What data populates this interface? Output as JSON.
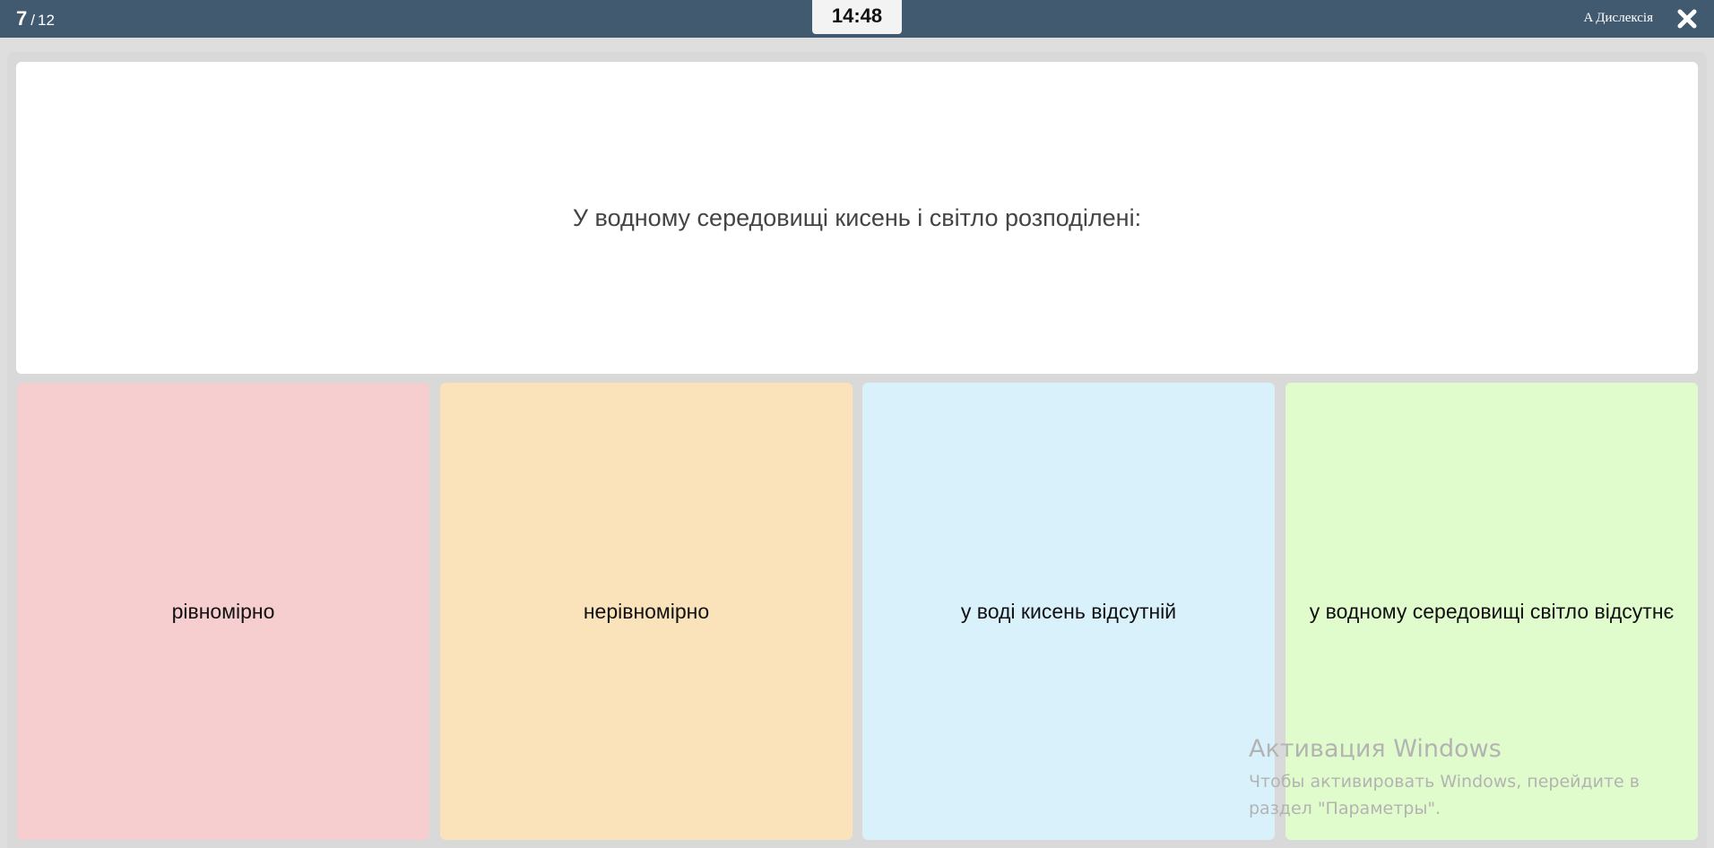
{
  "header": {
    "progress_current": "7",
    "progress_separator": "/",
    "progress_total": "12",
    "timer": "14:48",
    "dyslexia_label": "A Дислексія",
    "close_icon": "close-icon"
  },
  "question": {
    "text": "У водному середовищі кисень і світло розподілені:"
  },
  "answers": [
    {
      "label": "рівномірно",
      "color": "#f6cecf"
    },
    {
      "label": "нерівномірно",
      "color": "#fae2bb"
    },
    {
      "label": "у воді кисень відсутній",
      "color": "#d8f1fb"
    },
    {
      "label": "у водному середовищі світло відсутнє",
      "color": "#e0fccc"
    }
  ],
  "watermark": {
    "title": "Активация Windows",
    "line1": "Чтобы активировать Windows, перейдите в",
    "line2": "раздел \"Параметры\"."
  },
  "colors": {
    "topbar": "#425a70",
    "stage": "#d9d9d9"
  }
}
